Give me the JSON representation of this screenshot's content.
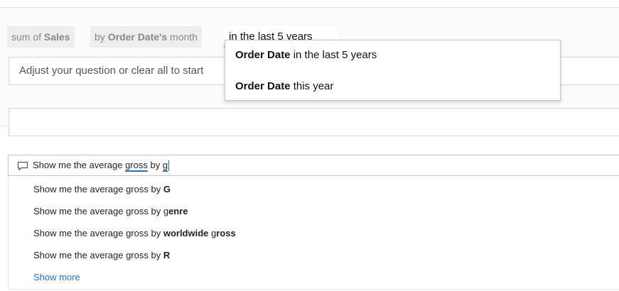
{
  "top": {
    "pills": [
      {
        "prefix": "sum of ",
        "bold": "Sales",
        "suffix": ""
      },
      {
        "prefix": "by ",
        "bold": "Order Date's",
        "suffix": " month"
      }
    ],
    "active_input": "in the last 5 years",
    "hint": "Adjust your question or clear all to start",
    "dropdown": [
      {
        "bold": "Order Date",
        "rest": " in the last 5 years"
      },
      {
        "bold": "Order Date",
        "rest": " this year"
      }
    ]
  },
  "query": {
    "icon": "chat-bubble-icon",
    "prefix": "Show me the average ",
    "word": "gross",
    "middle": " by ",
    "typed": "g"
  },
  "suggestions": [
    {
      "parts": [
        {
          "t": "Show me the average gross by ",
          "b": false
        },
        {
          "t": "G",
          "b": true
        }
      ]
    },
    {
      "parts": [
        {
          "t": "Show me the average gross by g",
          "b": false
        },
        {
          "t": "enre",
          "b": true
        }
      ]
    },
    {
      "parts": [
        {
          "t": "Show me the average gross by ",
          "b": false
        },
        {
          "t": "worldwide",
          "b": true
        },
        {
          "t": " g",
          "b": false
        },
        {
          "t": "ross",
          "b": true
        }
      ]
    },
    {
      "parts": [
        {
          "t": "Show me the average gross by ",
          "b": false
        },
        {
          "t": "R",
          "b": true
        }
      ]
    }
  ],
  "show_more": "Show more",
  "colors": {
    "accent": "#2c6fb5",
    "input_underline": "#6aa0c8"
  }
}
